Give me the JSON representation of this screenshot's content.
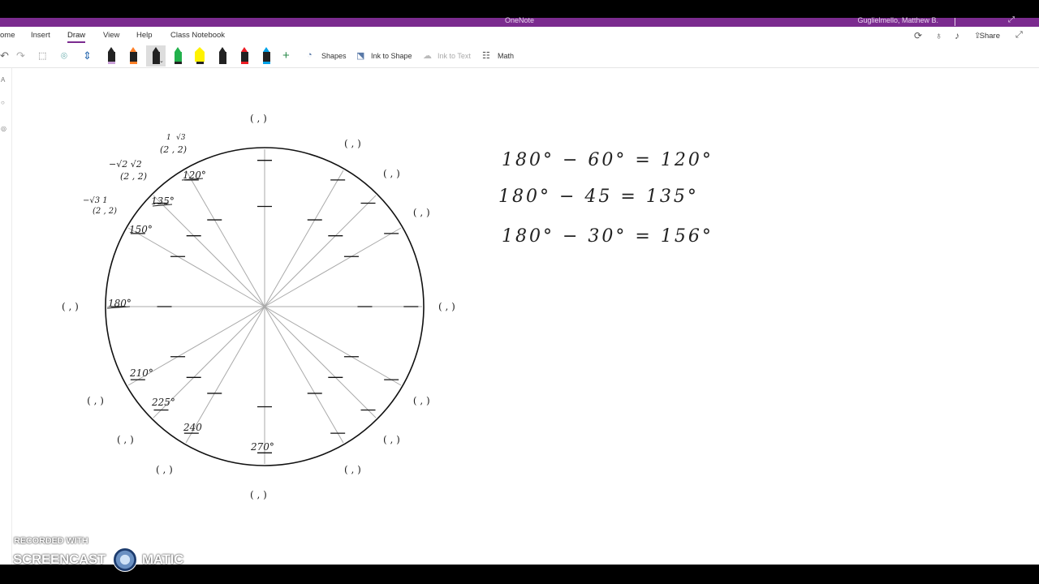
{
  "app": {
    "title": "OneNote",
    "user": "Guglielmello, Matthew B."
  },
  "menu": {
    "tabs": [
      "ome",
      "Insert",
      "Draw",
      "View",
      "Help",
      "Class Notebook"
    ],
    "active_tab": "Draw",
    "share_label": "Share"
  },
  "toolbar": {
    "shapes_label": "Shapes",
    "ink_to_shape_label": "Ink to Shape",
    "ink_to_text_label": "Ink to Text",
    "math_label": "Math",
    "pen_colors": [
      "#c9a0d8",
      "#ff7f27",
      "#222222",
      "#22b14c",
      "#fff200",
      "#222222",
      "#ed1c24",
      "#00a2e8"
    ]
  },
  "notes": {
    "circle_labels": {
      "deg_120": "120°",
      "deg_135": "135°",
      "deg_150": "150°",
      "deg_180": "180°",
      "deg_210": "210°",
      "deg_225": "225°",
      "deg_240": "240",
      "deg_270": "270°",
      "coord_120_a": "1",
      "coord_120_b": "√3",
      "coord_120_c": "(2 , 2)",
      "coord_135_a": "−√2 √2",
      "coord_135_b": "(2 , 2)",
      "coord_150_a": "−√3  1",
      "coord_150_b": "(2 , 2)",
      "empty_pair": "(  ,  )"
    },
    "equations": [
      "180° − 60° = 120°",
      "180° − 45 = 135°",
      "180° − 30° = 156°"
    ]
  },
  "watermark": {
    "line1": "RECORDED WITH",
    "line2a": "SCREENCAST",
    "line2b": "MATIC"
  }
}
